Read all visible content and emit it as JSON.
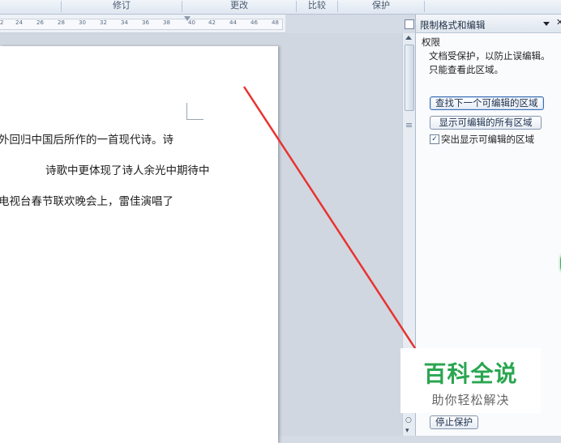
{
  "ribbon": {
    "groups": [
      "修订",
      "更改",
      "比较",
      "保护"
    ]
  },
  "ruler": {
    "ticks": [
      "2",
      "24",
      "26",
      "28",
      "30",
      "32",
      "34",
      "36",
      "38",
      "40",
      "42",
      "44",
      "46",
      "48"
    ]
  },
  "document": {
    "lines": [
      "外回归中国后所作的一首现代诗。诗",
      "诗歌中更体现了诗人余光中期待中",
      "电视台春节联欢晚会上，雷佳演唱了"
    ]
  },
  "pane": {
    "title": "限制格式和编辑",
    "section_label": "权限",
    "info_line1": "文档受保护，以防止误编辑。",
    "info_line2": "只能查看此区域。",
    "find_next_button": "查找下一个可编辑的区域",
    "show_all_button": "显示可编辑的所有区域",
    "highlight_checkbox_label": "突出显示可编辑的区域",
    "highlight_checked": true,
    "stop_protection_button": "停止保护"
  },
  "watermark": {
    "title": "百科全说",
    "subtitle": "助你轻松解决"
  },
  "colors": {
    "annotation_line": "#e8332f",
    "watermark_green": "#2aa650"
  }
}
